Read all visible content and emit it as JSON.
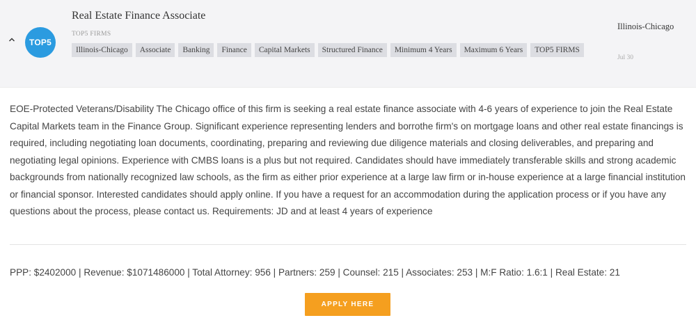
{
  "colors": {
    "accent": "#f59f1f",
    "logo_bg": "#2b9be0",
    "header_bg": "#f4f4f6",
    "tag_bg": "#dcdde2"
  },
  "header": {
    "collapse_icon": "chevron-up-icon",
    "logo_text": "TOP5",
    "title": "Real Estate Finance Associate",
    "firm_label": "TOP5 FIRMS",
    "tags": [
      "Illinois-Chicago",
      "Associate",
      "Banking",
      "Finance",
      "Capital Markets",
      "Structured Finance",
      "Minimum 4 Years",
      "Maximum 6 Years",
      "TOP5 FIRMS"
    ],
    "location": "Illinois-Chicago",
    "date": "Jul 30"
  },
  "body": {
    "description": "EOE-Protected Veterans/Disability The Chicago office of this firm is seeking a real estate finance associate with 4-6 years of experience to join the Real Estate Capital Markets team in the Finance Group. Significant experience representing lenders and borrothe firm's on mortgage loans and other real estate financings is required, including negotiating loan documents, coordinating, preparing and reviewing due diligence materials and closing deliverables, and preparing and negotiating legal opinions. Experience with CMBS loans is a plus but not required. Candidates should have immediately transferable skills and strong academic backgrounds from nationally recognized law schools, as the firm as either prior experience at a large law firm or in-house experience at a large financial institution or financial sponsor. Interested candidates should apply online. If you have a request for an accommodation during the application process or if you have any questions about the process, please contact us. Requirements: JD and at least 4 years of experience",
    "stats": "PPP: $2402000 | Revenue: $1071486000 | Total Attorney: 956 | Partners: 259 | Counsel: 215 | Associates: 253 | M:F Ratio: 1.6:1 | Real Estate: 21",
    "apply_label": "APPLY HERE"
  }
}
